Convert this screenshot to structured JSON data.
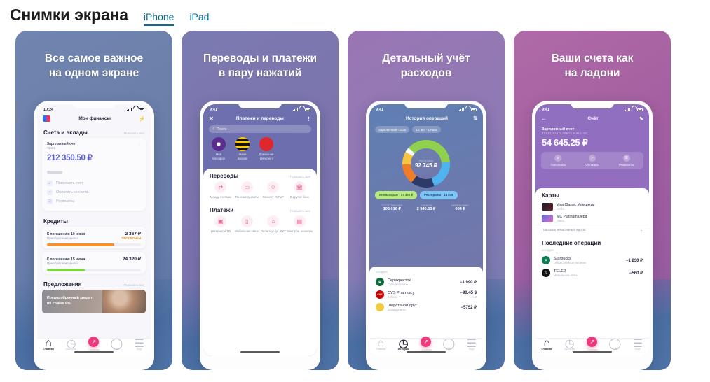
{
  "header": {
    "title": "Снимки экрана",
    "tabs": [
      {
        "label": "iPhone",
        "active": true
      },
      {
        "label": "iPad",
        "active": false
      }
    ]
  },
  "colors": {
    "accent_link": "#0b6e8f",
    "fab_pink": "#ec3a7e",
    "amount_purple": "#5a5fd6",
    "overdue_orange": "#f0922d",
    "progress_green": "#7dd44b"
  },
  "screenshots": [
    {
      "caption": "Все самое важное\nна одном экране",
      "caption_line1": "Все самое важное",
      "caption_line2": "на одном экране",
      "gradient": "linear-gradient(150deg,#6f85ae 0%, #6c7fab 38%, #5d76a5 100%)",
      "phone": {
        "status_time": "10:24",
        "nav_title": "Мои финансы",
        "sections": {
          "accounts_title": "Счета и вклады",
          "show_all": "Показать все",
          "account_name": "Зарплатный счет",
          "account_number": "*3481",
          "balance": "212 350.50 ₽",
          "actions": [
            {
              "label": "Пополнить счёт",
              "icon": "arrow-down-icon"
            },
            {
              "label": "Оплатить со счета",
              "icon": "arrow-up-icon"
            },
            {
              "label": "Реквизиты",
              "icon": "document-icon"
            }
          ],
          "credits_title": "Кредиты",
          "credits": [
            {
              "due": "К погашению 10 июня",
              "amount": "2 367 ₽",
              "purpose": "Приобретение жилья",
              "status": "ПРОСРОЧЕН",
              "bar_pct": 72,
              "bar_color": "#f0922d"
            },
            {
              "due": "К погашению 15 июня",
              "amount": "24 320 ₽",
              "purpose": "Приобретение жилья",
              "status": "",
              "bar_pct": 40,
              "bar_color": "#7dd44b"
            }
          ],
          "offers_title": "Предложения",
          "promo_line1": "Предодобренный кредит",
          "promo_line2": "по ставке 6%"
        },
        "tabbar": [
          {
            "label": "Главная",
            "icon": "home-icon",
            "active": true
          },
          {
            "label": "История",
            "icon": "clock-icon",
            "active": false
          },
          {
            "label": "Платежи",
            "icon": "arrow-up-right-icon",
            "active": false,
            "fab": true
          },
          {
            "label": "Чат",
            "icon": "chat-icon",
            "active": false
          },
          {
            "label": "Ещё",
            "icon": "menu-icon",
            "active": false
          }
        ]
      }
    },
    {
      "caption_line1": "Переводы и платежи",
      "caption_line2": "в пару нажатий",
      "gradient": "linear-gradient(150deg,#7b7bb0 0%, #7d73ae 45%, #6f6fa8 100%)",
      "phone": {
        "status_time": "9:41",
        "nav_title": "Платежи и переводы",
        "close_icon": "close-icon",
        "more_icon": "more-vertical-icon",
        "search_placeholder": "Поиск",
        "providers": [
          {
            "name": "Мой Мегафон",
            "color": "#5b2d8e"
          },
          {
            "name": "Женя Билайн",
            "color": "#ffcc00"
          },
          {
            "name": "Домашний Интернет",
            "color": "#e0272c"
          }
        ],
        "transfers_title": "Переводы",
        "show_all": "Показать все",
        "transfers": [
          {
            "label": "Между счетами",
            "icon": "transfer-icon"
          },
          {
            "label": "По номеру карты",
            "icon": "card-icon"
          },
          {
            "label": "Клиенту УБРиР",
            "icon": "person-icon"
          },
          {
            "label": "В другой банк",
            "icon": "bank-icon"
          }
        ],
        "payments_title": "Платежи",
        "payments": [
          {
            "label": "Интернет и ТВ",
            "icon": "tv-icon"
          },
          {
            "label": "Мобильная связь",
            "icon": "phone-icon"
          },
          {
            "label": "Оплата услуг ЖКХ",
            "icon": "home-icon"
          },
          {
            "label": "Электрон. кошелек",
            "icon": "wallet-icon"
          }
        ]
      }
    },
    {
      "caption_line1": "Детальный учёт",
      "caption_line2": "расходов",
      "gradient": "linear-gradient(150deg,#9a76b3 0%, #8f7ab5 40%, #6f7cae 100%)",
      "phone": {
        "status_time": "9:41",
        "nav_title": "История операций",
        "filter_icon": "sort-filter-icon",
        "chips": [
          "Зарплатный *3430",
          "12 авг - 19 авг"
        ],
        "donut_label": "РАСХОДЫ",
        "donut_total": "92 745 ₽",
        "legend": [
          {
            "label": "Иноваторам",
            "value": "37 390 ₽",
            "bg": "#b8e986",
            "fg": "#3d6b1e"
          },
          {
            "label": "Рестораны",
            "value": "24 878",
            "bg": "#7ec4f5",
            "fg": "#12496f"
          }
        ],
        "stats": [
          {
            "key": "ПОСТУПЛЕНИЯ",
            "value": "105 616 ₽"
          },
          {
            "key": "КЭШБЭК",
            "value": "2 540.53 ₽"
          },
          {
            "key": "БЕРЕЖЛИВО",
            "value": "604 ₽"
          }
        ],
        "tx_head": "сегодня",
        "transactions": [
          {
            "name": "Перекресток",
            "category": "Супермаркеты",
            "amount": "−1 990 ₽",
            "sub": "",
            "color": "#0b6b3a",
            "initial": "✿"
          },
          {
            "name": "CVS Pharmacy",
            "category": "Аптеки",
            "amount": "−90.45 $",
            "sub": "+13 ₽",
            "color": "#cc0000",
            "initial": "CVS"
          },
          {
            "name": "Шерстяной друг",
            "category": "Зоомагазины",
            "amount": "−5752 ₽",
            "sub": "",
            "color": "#f1cb3f",
            "initial": ""
          }
        ],
        "tabbar_active": "История"
      }
    },
    {
      "caption_line1": "Ваши счета как",
      "caption_line2": "на ладони",
      "gradient": "linear-gradient(150deg,#b06aa8 0%, #a35fa0 40%, #8f5a9e 100%)",
      "phone": {
        "status_time": "9:41",
        "nav_title": "Счёт",
        "back_icon": "arrow-left-icon",
        "edit_icon": "pencil-icon",
        "account_name": "Зарплатный счет",
        "account_number": "40817 810 1 76843 9 816 43",
        "balance": "54 645.25 ₽",
        "actions": [
          {
            "label": "Пополнить",
            "icon": "arrow-down-icon"
          },
          {
            "label": "Оплатить",
            "icon": "arrow-up-icon"
          },
          {
            "label": "Реквизиты",
            "icon": "document-icon"
          }
        ],
        "cards_title": "Карты",
        "cards": [
          {
            "name": "Visa Classic Максимум",
            "number": "*0714",
            "gradient": "linear-gradient(135deg,#1d1d2b 0%, #3a1f2b 50%, #7a1f2b 100%)"
          },
          {
            "name": "MC Platinum Debit",
            "number": "*8684",
            "gradient": "linear-gradient(135deg,#5b6fd4 0%, #a06fd0 55%, #e06ba0 100%)"
          }
        ],
        "show_inactive": "Показать неактивные карты",
        "chevron_icon": "chevron-down-icon",
        "recent_title": "Последние операции",
        "tx_head": "сегодня",
        "transactions": [
          {
            "name": "Starbucks",
            "category": "Общественное питание",
            "amount": "−1 230 ₽",
            "color": "#0b7d53",
            "initial": "★"
          },
          {
            "name": "TELE2",
            "category": "Мобильная связь",
            "amount": "−560 ₽",
            "color": "#111111",
            "initial": "T2"
          }
        ],
        "tabbar_active": "Главная"
      }
    }
  ],
  "tabbar_common": [
    {
      "label": "Главная",
      "icon": "home-icon"
    },
    {
      "label": "История",
      "icon": "clock-icon"
    },
    {
      "label": "Платежи",
      "icon": "arrow-up-right-icon"
    },
    {
      "label": "Чат",
      "icon": "chat-icon"
    },
    {
      "label": "Ещё",
      "icon": "menu-icon"
    }
  ]
}
